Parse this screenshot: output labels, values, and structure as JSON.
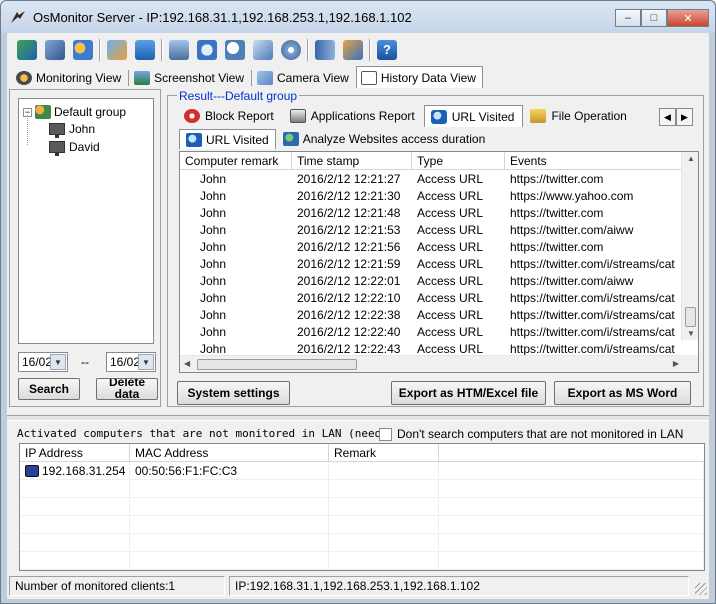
{
  "window": {
    "title": "OsMonitor Server - IP:192.168.31.1,192.168.253.1,192.168.1.102",
    "minimize_glyph": "‒",
    "maximize_glyph": "□",
    "close_glyph": "✕"
  },
  "toolbar": {
    "icons": [
      "group-icon",
      "settings-icon",
      "users-icon",
      "edit-icon",
      "info-icon",
      "monitor-icon",
      "send-icon",
      "search-icon",
      "windows-icon",
      "disk-icon",
      "book-icon",
      "report-icon",
      "help-icon"
    ]
  },
  "view_tabs": [
    {
      "label": "Monitoring View",
      "icon": "monitoring-icon"
    },
    {
      "label": "Screenshot View",
      "icon": "screenshot-icon"
    },
    {
      "label": "Camera View",
      "icon": "camera-icon"
    },
    {
      "label": "History Data View",
      "icon": "history-icon",
      "active": true
    }
  ],
  "tree": {
    "root": "Default group",
    "expander": "−",
    "children": [
      "John",
      "David"
    ]
  },
  "date_range": {
    "from": "16/02",
    "separator": "--",
    "to": "16/02"
  },
  "left_buttons": {
    "search": "Search",
    "delete": "Delete data"
  },
  "result": {
    "legend": "Result---Default group",
    "tabs": [
      {
        "label": "Block Report",
        "icon": "block-icon"
      },
      {
        "label": "Applications Report",
        "icon": "applications-icon"
      },
      {
        "label": "URL Visited",
        "icon": "url-icon",
        "active": true
      },
      {
        "label": "File Operation",
        "icon": "file-icon"
      }
    ],
    "scroll_left": "◀",
    "scroll_right": "▶",
    "subtabs": [
      {
        "label": "URL Visited",
        "icon": "url-icon",
        "active": true
      },
      {
        "label": "Analyze Websites access duration",
        "icon": "analyze-icon"
      }
    ]
  },
  "events_table": {
    "columns": [
      "Computer remark",
      "Time stamp",
      "Type",
      "Events"
    ],
    "rows": [
      [
        "John",
        "2016/2/12 12:21:27",
        "Access URL",
        "https://twitter.com"
      ],
      [
        "John",
        "2016/2/12 12:21:30",
        "Access URL",
        "https://www.yahoo.com"
      ],
      [
        "John",
        "2016/2/12 12:21:48",
        "Access URL",
        "https://twitter.com"
      ],
      [
        "John",
        "2016/2/12 12:21:53",
        "Access URL",
        "https://twitter.com/aiww"
      ],
      [
        "John",
        "2016/2/12 12:21:56",
        "Access URL",
        "https://twitter.com"
      ],
      [
        "John",
        "2016/2/12 12:21:59",
        "Access URL",
        "https://twitter.com/i/streams/cat"
      ],
      [
        "John",
        "2016/2/12 12:22:01",
        "Access URL",
        "https://twitter.com/aiww"
      ],
      [
        "John",
        "2016/2/12 12:22:10",
        "Access URL",
        "https://twitter.com/i/streams/cat"
      ],
      [
        "John",
        "2016/2/12 12:22:38",
        "Access URL",
        "https://twitter.com/i/streams/cat"
      ],
      [
        "John",
        "2016/2/12 12:22:40",
        "Access URL",
        "https://twitter.com/i/streams/cat"
      ],
      [
        "John",
        "2016/2/12 12:22:43",
        "Access URL",
        "https://twitter.com/i/streams/cat"
      ]
    ]
  },
  "action_buttons": {
    "system_settings": "System settings",
    "export_htm": "Export as HTM/Excel file",
    "export_word": "Export as MS Word"
  },
  "lan": {
    "note": "Activated computers that are not monitored in LAN (need to i",
    "checkbox_label": "Don't search computers that are not monitored in LAN",
    "columns": [
      "IP Address",
      "MAC Address",
      "Remark"
    ],
    "rows": [
      [
        "192.168.31.254",
        "00:50:56:F1:FC:C3",
        ""
      ]
    ]
  },
  "status": {
    "clients": "Number of monitored clients:1",
    "ips": "IP:192.168.31.1,192.168.253.1,192.168.1.102"
  }
}
